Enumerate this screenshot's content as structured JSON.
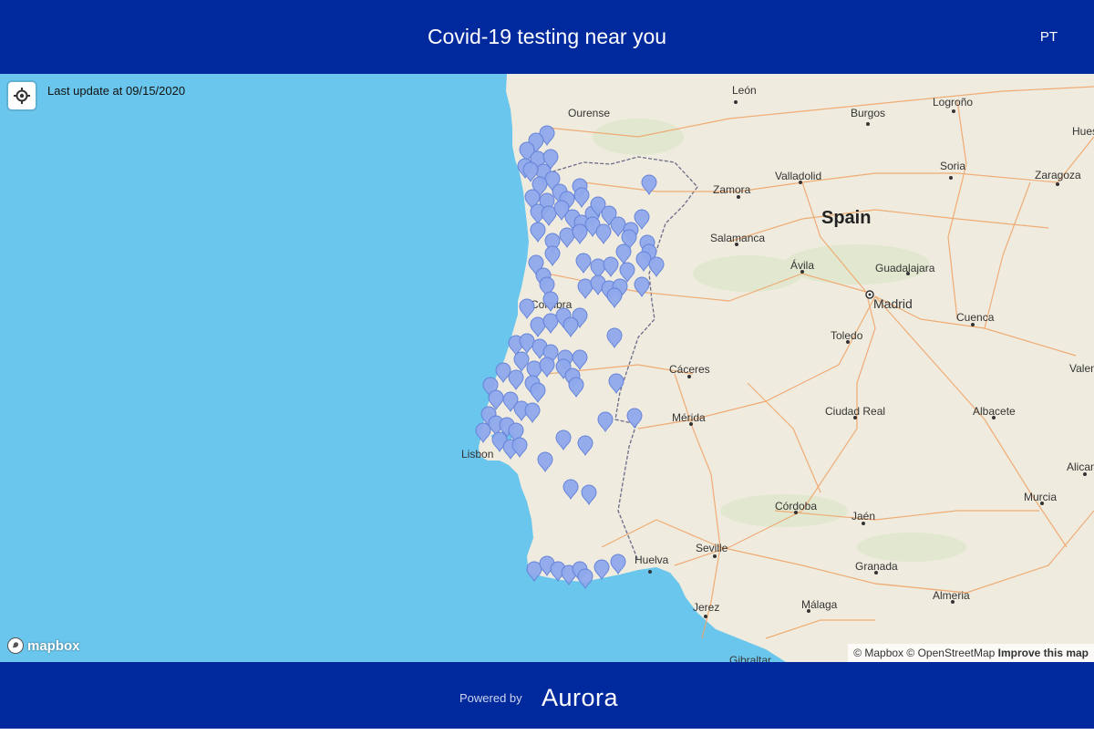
{
  "header": {
    "title": "Covid-19 testing near you",
    "lang": "PT"
  },
  "map": {
    "last_update": "Last update at 09/15/2020",
    "cities": [
      "León",
      "Ourense",
      "Burgos",
      "Logroño",
      "Huesca",
      "Soria",
      "Zaragoza",
      "Valladolid",
      "Zamora",
      "Spain",
      "Salamanca",
      "Ávila",
      "Guadalajara",
      "Madrid",
      "Cuenca",
      "Toledo",
      "Cáceres",
      "Mérida",
      "Ciudad Real",
      "Albacete",
      "Valencia",
      "Alicante",
      "Murcia",
      "Lisbon",
      "Córdoba",
      "Jaén",
      "Huelva",
      "Seville",
      "Granada",
      "Almeria",
      "Málaga",
      "Jerez",
      "Gibraltar",
      "Coimbra"
    ],
    "colors": {
      "water": "#6ac6ec",
      "land": "#efecdf",
      "marker": "#8fa9ec",
      "marker_stroke": "#6683d8",
      "header": "#00299d"
    }
  },
  "mapbox_logo": "mapbox",
  "attribution": {
    "mapbox": "© Mapbox",
    "osm": "© OpenStreetMap",
    "improve": "Improve this map"
  },
  "footer": {
    "powered_by": "Powered by",
    "brand": "Aurora"
  }
}
